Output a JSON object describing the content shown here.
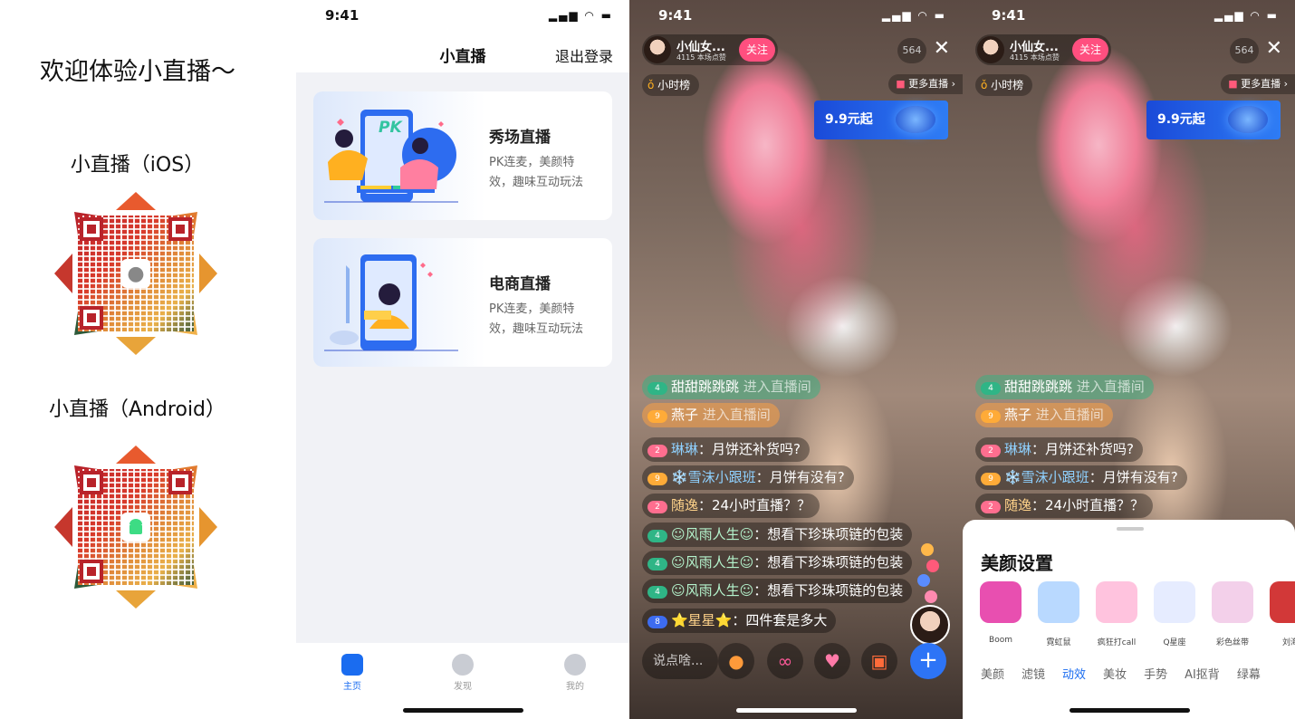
{
  "panel1": {
    "welcome": "欢迎体验小直播～",
    "ios_label": "小直播（iOS）",
    "android_label": "小直播（Android）"
  },
  "panel2": {
    "time": "9:41",
    "title": "小直播",
    "logout": "退出登录",
    "cards": [
      {
        "title": "秀场直播",
        "desc": "PK连麦，美颜特效，趣味互动玩法",
        "pk_badge": "PK"
      },
      {
        "title": "电商直播",
        "desc": "PK连麦，美颜特效，趣味互动玩法"
      }
    ],
    "tabs": [
      {
        "label": "主页",
        "icon": "home-icon"
      },
      {
        "label": "发现",
        "icon": "compass-icon"
      },
      {
        "label": "我的",
        "icon": "user-icon"
      }
    ]
  },
  "live": {
    "time": "9:41",
    "anchor_name": "小仙女...",
    "anchor_sub": "4115 本场点赞",
    "follow": "关注",
    "viewers": "564",
    "rank": "小时榜",
    "more": "更多直播 ›",
    "promo": "9.9元起",
    "messages": [
      {
        "level": "4",
        "name": "甜甜跳跳跳",
        "text": "进入直播间",
        "style": "green"
      },
      {
        "level": "9",
        "name": "燕子",
        "text": "进入直播间",
        "style": "orange"
      },
      {
        "level": "2",
        "name": "琳琳",
        "text": "：月饼还补货吗?",
        "style": "pink"
      },
      {
        "level": "9",
        "name": "❄️雪沫小跟班",
        "text": "：月饼有没有?",
        "style": "gold"
      },
      {
        "level": "2",
        "name": "随逸",
        "text": "：24小时直播？？",
        "style": "pink"
      },
      {
        "level": "4",
        "name": "☺风雨人生☺",
        "text": "：想看下珍珠项链的包装",
        "style": "teal"
      },
      {
        "level": "4",
        "name": "☺风雨人生☺",
        "text": "：想看下珍珠项链的包装",
        "style": "teal"
      },
      {
        "level": "4",
        "name": "☺风雨人生☺",
        "text": "：想看下珍珠项链的包装",
        "style": "teal"
      },
      {
        "level": "8",
        "name": "⭐星星⭐",
        "text": "：四件套是多大",
        "style": "blue"
      }
    ],
    "say_placeholder": "说点啥...",
    "bottom_icons": [
      "beauty-icon",
      "link-mic-icon",
      "heart-like-icon",
      "gift-icon",
      "plus-icon"
    ],
    "plus": "+"
  },
  "beauty": {
    "title": "美颜设置",
    "effects": [
      {
        "label": "Boom",
        "color": "#e84fb0"
      },
      {
        "label": "霓虹鼠",
        "color": "#b9d9ff"
      },
      {
        "label": "疯狂打call",
        "color": "#ffc3de"
      },
      {
        "label": "Q星座",
        "color": "#e6ecff"
      },
      {
        "label": "彩色丝带",
        "color": "#f3d0ea"
      },
      {
        "label": "刘海",
        "color": "#d23838"
      }
    ],
    "tabs": [
      "美颜",
      "滤镜",
      "动效",
      "美妆",
      "手势",
      "AI抠背",
      "绿幕"
    ],
    "active_tab": "动效"
  }
}
